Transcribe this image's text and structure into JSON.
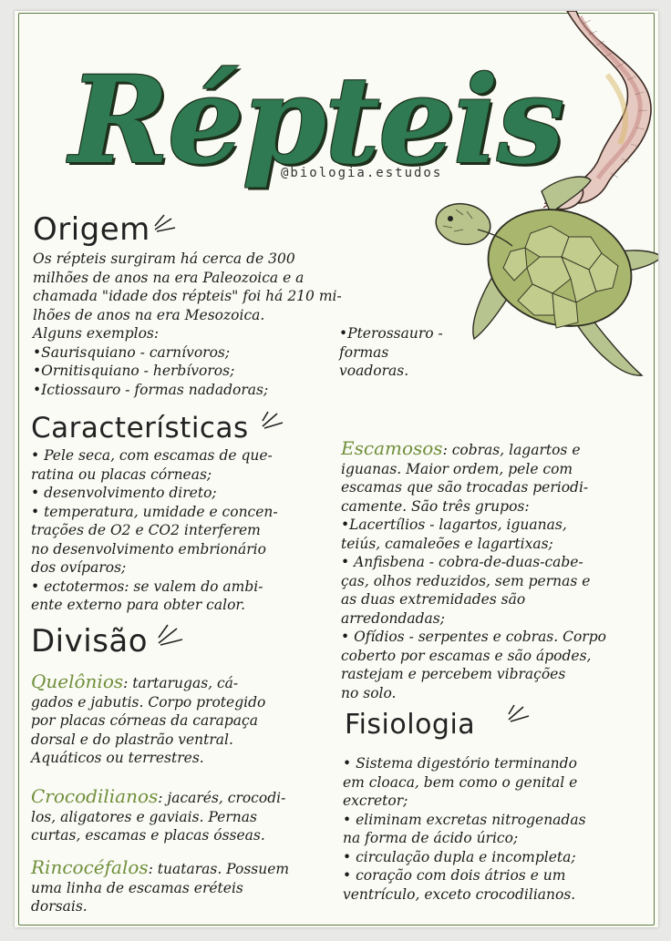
{
  "title": "Répteis",
  "handle": "@biologia.estudos",
  "origem": {
    "heading": "Origem",
    "lines": [
      "Os répteis surgiram há cerca de 300",
      "milhões de anos na era Paleozoica e a",
      "chamada \"idade dos répteis\" foi há 210 mi-",
      "lhões de anos na era Mesozoica.",
      "Alguns exemplos:",
      "•Saurisquiano - carnívoros;",
      "•Ornitisquiano - herbívoros;",
      "•Ictiossauro - formas nadadoras;"
    ],
    "side_note": [
      "•Pterossauro -",
      "formas",
      "voadoras."
    ]
  },
  "caracteristicas": {
    "heading": "Características",
    "lines": [
      "• Pele seca, com escamas de que-",
      "ratina ou placas córneas;",
      "• desenvolvimento direto;",
      "• temperatura, umidade e concen-",
      "trações de O2 e CO2 interferem",
      "no desenvolvimento embrionário",
      "dos ovíparos;",
      "• ectotermos: se valem do ambi-",
      "ente externo para obter calor."
    ]
  },
  "divisao": {
    "heading": "Divisão",
    "quelonios": {
      "term": "Quelônios",
      "first": ": tartarugas, cá-",
      "lines": [
        "gados e jabutis. Corpo protegido",
        "por placas córneas da carapaça",
        "dorsal e do plastrão ventral.",
        "Aquáticos ou terrestres."
      ]
    },
    "crocodilianos": {
      "term": "Crocodilianos",
      "first": ": jacarés, crocodi-",
      "lines": [
        "los, aligatores e gaviais. Pernas",
        "curtas, escamas e placas ósseas."
      ]
    },
    "rincocefalos": {
      "term": "Rincocéfalos",
      "first": ": tuataras. Possuem",
      "lines": [
        "uma linha de escamas eréteis",
        "dorsais."
      ]
    }
  },
  "escamosos": {
    "term": "Escamosos",
    "first": ": cobras, lagartos e",
    "lines": [
      "iguanas. Maior ordem, pele com",
      "escamas que são trocadas periodi-",
      "camente. São três grupos:",
      "•Lacertílios - lagartos, iguanas,",
      "teiús, camaleões e lagartixas;",
      "• Anfisbena - cobra-de-duas-cabe-",
      "ças, olhos reduzidos, sem pernas e",
      "as duas extremidades são",
      "arredondadas;",
      "• Ofídios - serpentes e cobras. Corpo",
      "coberto por escamas e são ápodes,",
      "rastejam e percebem vibrações",
      "no solo."
    ]
  },
  "fisiologia": {
    "heading": "Fisiologia",
    "lines": [
      "• Sistema digestório terminando",
      "em cloaca, bem como o genital e",
      "excretor;",
      "• eliminam excretas nitrogenadas",
      "na forma de ácido úrico;",
      "• circulação dupla e incompleta;",
      "• coração com dois átrios e um",
      "ventrículo, exceto crocodilianos."
    ]
  },
  "colors": {
    "title_green": "#2f7a52",
    "olive": "#6f8f3a",
    "ink": "#1c1c1c",
    "frame": "#5b7a43"
  }
}
